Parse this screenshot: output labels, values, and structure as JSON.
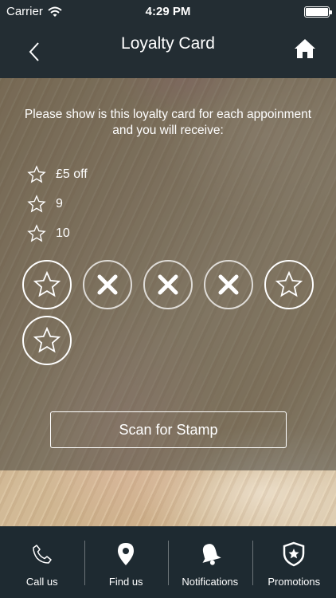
{
  "status_bar": {
    "carrier": "Carrier",
    "time": "4:29 PM"
  },
  "nav": {
    "title": "Loyalty Card",
    "back_icon": "chevron-left-icon",
    "home_icon": "home-icon"
  },
  "loyalty": {
    "intro": "Please show is this loyalty card for each appoinment and you will receive:",
    "rewards": [
      {
        "label": "£5 off"
      },
      {
        "label": "9"
      },
      {
        "label": "10"
      }
    ],
    "stamps": [
      "star",
      "x",
      "x",
      "x",
      "star",
      "star"
    ],
    "scan_label": "Scan for Stamp"
  },
  "tabs": [
    {
      "label": "Call us",
      "icon": "phone-icon"
    },
    {
      "label": "Find us",
      "icon": "map-pin-icon"
    },
    {
      "label": "Notifications",
      "icon": "bell-icon"
    },
    {
      "label": "Promotions",
      "icon": "shield-star-icon"
    }
  ],
  "colors": {
    "header": "#232d33",
    "tab_bar": "#1e2a31",
    "text": "#ffffff"
  }
}
